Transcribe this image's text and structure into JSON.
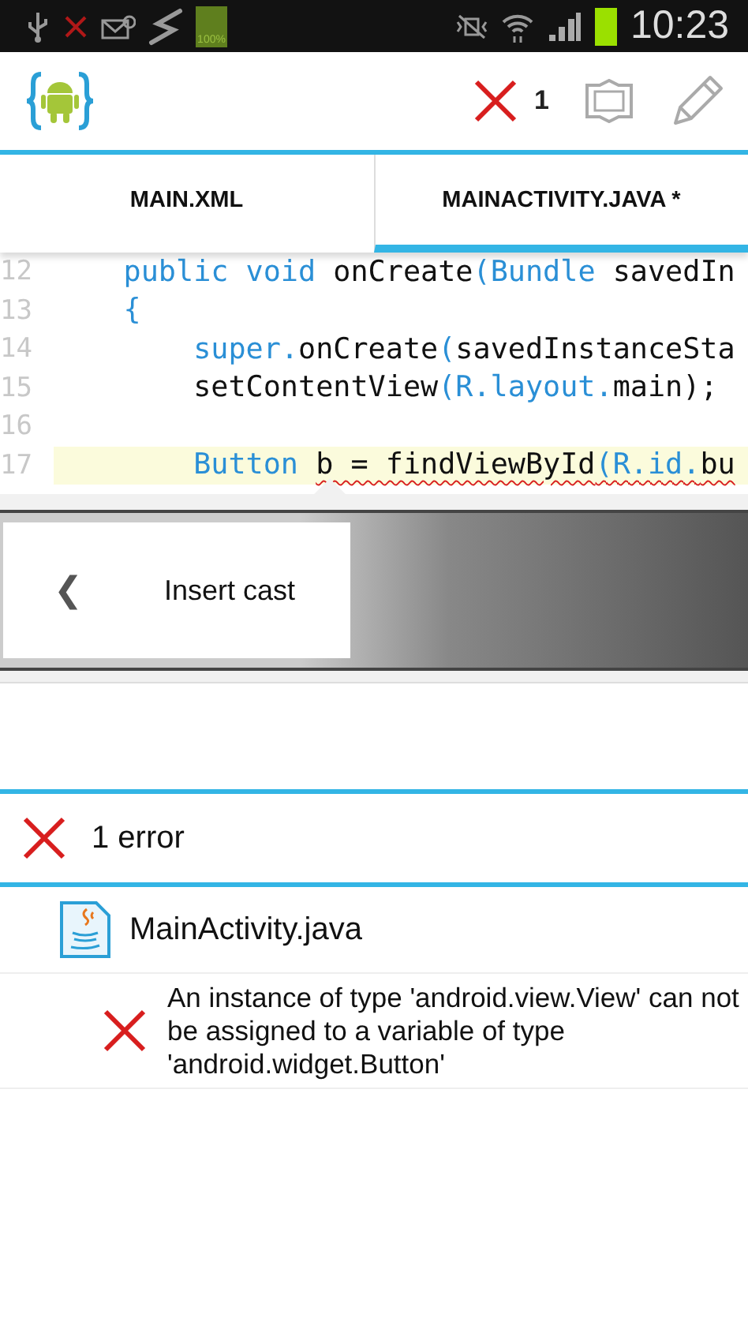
{
  "status_bar": {
    "battery_label": "100%",
    "time": "10:23"
  },
  "toolbar": {
    "error_count": "1"
  },
  "tabs": [
    {
      "label": "MAIN.XML",
      "selected": false
    },
    {
      "label": "MAINACTIVITY.JAVA *",
      "selected": true
    }
  ],
  "editor": {
    "lines": [
      {
        "number": "12",
        "current": false,
        "segments": [
          {
            "text": "    public void",
            "kind": "keyword",
            "error": false
          },
          {
            "text": " onCreate",
            "kind": "plain",
            "error": false
          },
          {
            "text": "(",
            "kind": "keyword",
            "error": false
          },
          {
            "text": "Bundle",
            "kind": "keyword",
            "error": false
          },
          {
            "text": " savedIn",
            "kind": "plain",
            "error": false
          }
        ]
      },
      {
        "number": "13",
        "current": false,
        "segments": [
          {
            "text": "    {",
            "kind": "keyword",
            "error": false
          }
        ]
      },
      {
        "number": "14",
        "current": false,
        "segments": [
          {
            "text": "        super",
            "kind": "keyword",
            "error": false
          },
          {
            "text": ".",
            "kind": "keyword",
            "error": false
          },
          {
            "text": "onCreate",
            "kind": "plain",
            "error": false
          },
          {
            "text": "(",
            "kind": "keyword",
            "error": false
          },
          {
            "text": "savedInstanceSta",
            "kind": "plain",
            "error": false
          }
        ]
      },
      {
        "number": "15",
        "current": false,
        "segments": [
          {
            "text": "        setContentView",
            "kind": "plain",
            "error": false
          },
          {
            "text": "(R.layout.",
            "kind": "keyword",
            "error": false
          },
          {
            "text": "main);",
            "kind": "plain",
            "error": false
          }
        ]
      },
      {
        "number": "16",
        "current": false
      },
      {
        "number": "17",
        "current": true,
        "segments": [
          {
            "text": "        Button ",
            "kind": "keyword",
            "error": false
          },
          {
            "text": "b = findViewById",
            "kind": "plain",
            "error": true
          },
          {
            "text": "(R.id.",
            "kind": "keyword",
            "error": true
          },
          {
            "text": "bu",
            "kind": "plain",
            "error": true
          }
        ]
      }
    ]
  },
  "quick_fix": {
    "label": "Insert cast",
    "back": "❮"
  },
  "problems": {
    "summary": "1 error",
    "file": "MainActivity.java",
    "message": "An instance of type 'android.view.View' can not be assigned to a variable of type 'android.widget.Button'"
  }
}
